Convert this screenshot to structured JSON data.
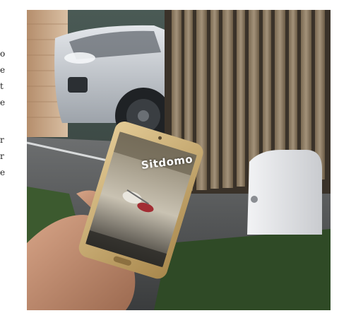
{
  "edge_text": {
    "glyphs": [
      "o",
      "e",
      "t",
      "e",
      "r",
      "r",
      "e"
    ]
  },
  "photo": {
    "scene": "hand-holding-smartphone-in-front-of-sliding-gate",
    "phone_logo": "Sitdomo"
  },
  "colors": {
    "background": "#ffffff",
    "gate_wood": "#8a7a62",
    "motor_housing": "#e6e7ea",
    "phone_gold": "#c9a86a",
    "car_body": "#c4c9d0"
  }
}
